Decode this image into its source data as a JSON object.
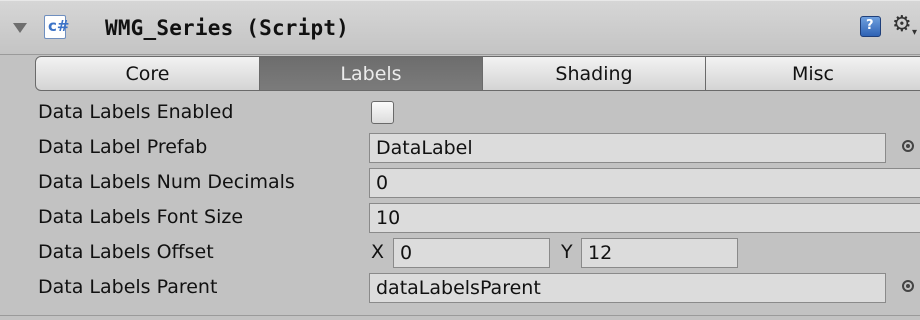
{
  "component": {
    "title": "WMG_Series (Script)",
    "script_icon_glyph": "c#",
    "help_icon_glyph": "?",
    "gear_icon_glyph": "⚙",
    "gear_arrow_glyph": "▾"
  },
  "tabs": [
    {
      "label": "Core",
      "active": false
    },
    {
      "label": "Labels",
      "active": true
    },
    {
      "label": "Shading",
      "active": false
    },
    {
      "label": "Misc",
      "active": false
    }
  ],
  "fields": {
    "enabled": {
      "label": "Data Labels Enabled",
      "checked": false
    },
    "prefab": {
      "label": "Data Label Prefab",
      "value": "DataLabel"
    },
    "decimals": {
      "label": "Data Labels Num Decimals",
      "value": "0"
    },
    "font_size": {
      "label": "Data Labels Font Size",
      "value": "10"
    },
    "offset": {
      "label": "Data Labels Offset",
      "x_label": "X",
      "x_value": "0",
      "y_label": "Y",
      "y_value": "12"
    },
    "parent": {
      "label": "Data Labels Parent",
      "value": "dataLabelsParent"
    }
  },
  "colors": {
    "panel": "#c2c2c2",
    "active_tab": "#737373",
    "field_bg": "#dcdcdc"
  }
}
